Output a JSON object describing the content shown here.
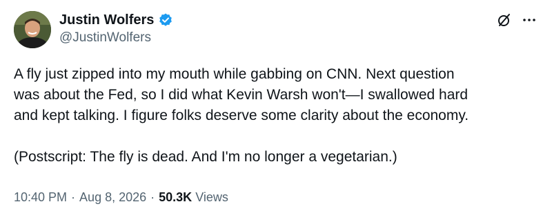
{
  "author": {
    "display_name": "Justin Wolfers",
    "handle": "@JustinWolfers",
    "verified": true,
    "verified_color": "#1d9bf0"
  },
  "actions": {
    "grok_icon": "grok-slash-icon",
    "more_icon": "more-horizontal-icon"
  },
  "tweet": {
    "paragraphs": [
      "A fly just zipped into my mouth while gabbing on CNN. Next question\nwas about the Fed, so I did what Kevin Warsh won't—I swallowed hard\nand kept talking. I figure folks deserve some clarity about the economy.",
      "(Postscript: The fly is dead. And I'm no longer a vegetarian.)"
    ]
  },
  "meta": {
    "time": "10:40 PM",
    "separator": "·",
    "date": "Aug 8, 2026",
    "views_count": "50.3K",
    "views_label": "Views"
  },
  "colors": {
    "text_primary": "#0f1419",
    "text_secondary": "#536471",
    "background": "#ffffff"
  }
}
